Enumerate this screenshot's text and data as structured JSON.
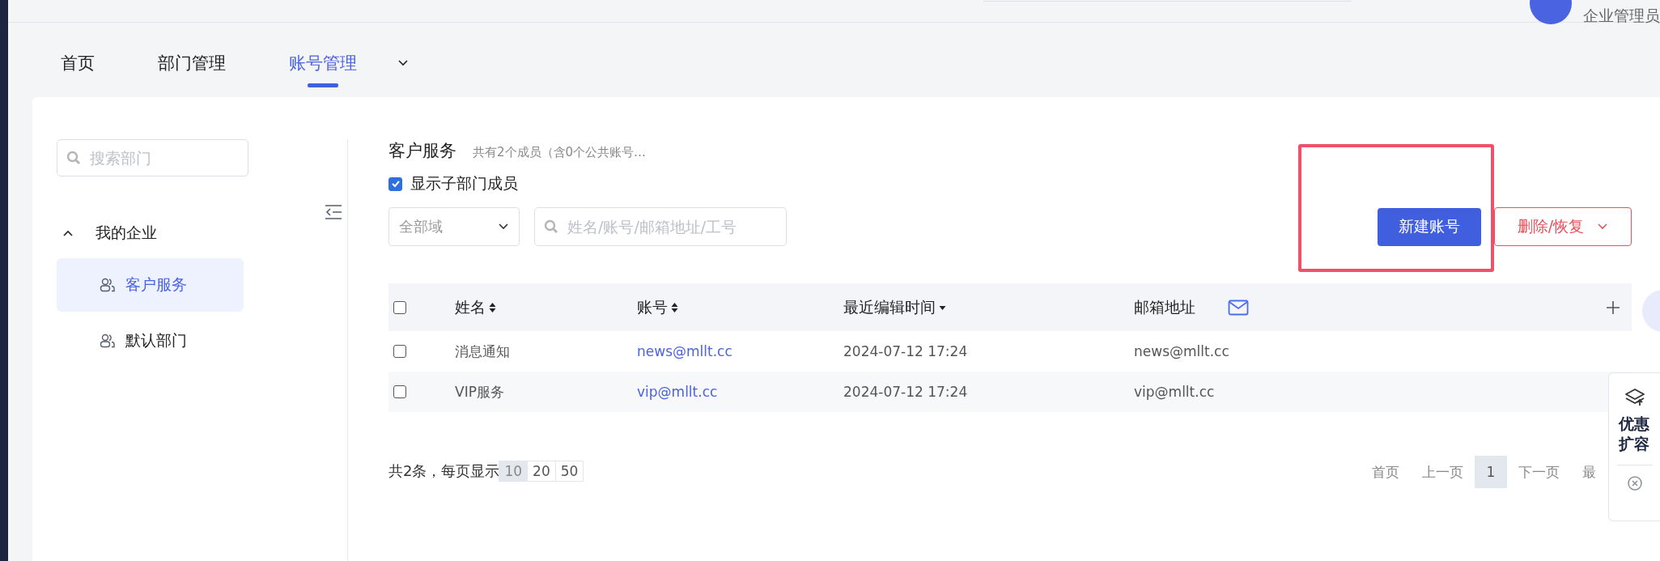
{
  "header": {
    "user_role": "企业管理员"
  },
  "nav_tabs": [
    {
      "label": "首页",
      "selected": false
    },
    {
      "label": "部门管理",
      "selected": false
    },
    {
      "label": "账号管理",
      "selected": true
    }
  ],
  "sidebar": {
    "search": {
      "placeholder": "搜索部门"
    },
    "tree": [
      {
        "label": "我的企业",
        "expanded": true,
        "children": [
          {
            "label": "客户服务",
            "selected": true
          },
          {
            "label": "默认部门",
            "selected": false
          }
        ]
      }
    ]
  },
  "department": {
    "title": "客户服务",
    "summary": "共有2个成员（含0个公共账号…",
    "show_sub_members": {
      "label": "显示子部门成员",
      "checked": true
    }
  },
  "filters": {
    "domain": {
      "value": "全部域"
    },
    "search": {
      "placeholder": "姓名/账号/邮箱地址/工号"
    }
  },
  "actions": {
    "new_button": {
      "label": "新建账号",
      "highlighted": true
    },
    "delete_button": {
      "label": "删除/恢复"
    }
  },
  "table": {
    "all_checked": false,
    "columns": [
      {
        "label": "姓名",
        "kind": "sortable"
      },
      {
        "label": "账号",
        "kind": "sortable"
      },
      {
        "label": "最近编辑时间",
        "kind": "sorted"
      },
      {
        "label": "邮箱地址",
        "kind": "plain"
      }
    ],
    "rows": [
      {
        "checked": false,
        "name": "消息通知",
        "account": "news@mllt.cc",
        "edited": "2024-07-12 17:24",
        "email": "news@mllt.cc"
      },
      {
        "checked": false,
        "name": "VIP服务",
        "account": "vip@mllt.cc",
        "edited": "2024-07-12 17:24",
        "email": "vip@mllt.cc"
      }
    ]
  },
  "footer": {
    "total": "共2条，每页显示",
    "page_sizes": [
      {
        "label": "10",
        "selected": true
      },
      {
        "label": "20",
        "selected": false
      },
      {
        "label": "50",
        "selected": false
      }
    ]
  },
  "pagination": [
    {
      "label": "首页",
      "kind": "link",
      "selected": false
    },
    {
      "label": "上一页",
      "kind": "link",
      "selected": false
    },
    {
      "label": "1",
      "kind": "page",
      "selected": true
    },
    {
      "label": "下一页",
      "kind": "link",
      "selected": false
    },
    {
      "label": "最",
      "kind": "link",
      "selected": false
    }
  ],
  "float_panel": {
    "label": "优惠扩容"
  }
}
